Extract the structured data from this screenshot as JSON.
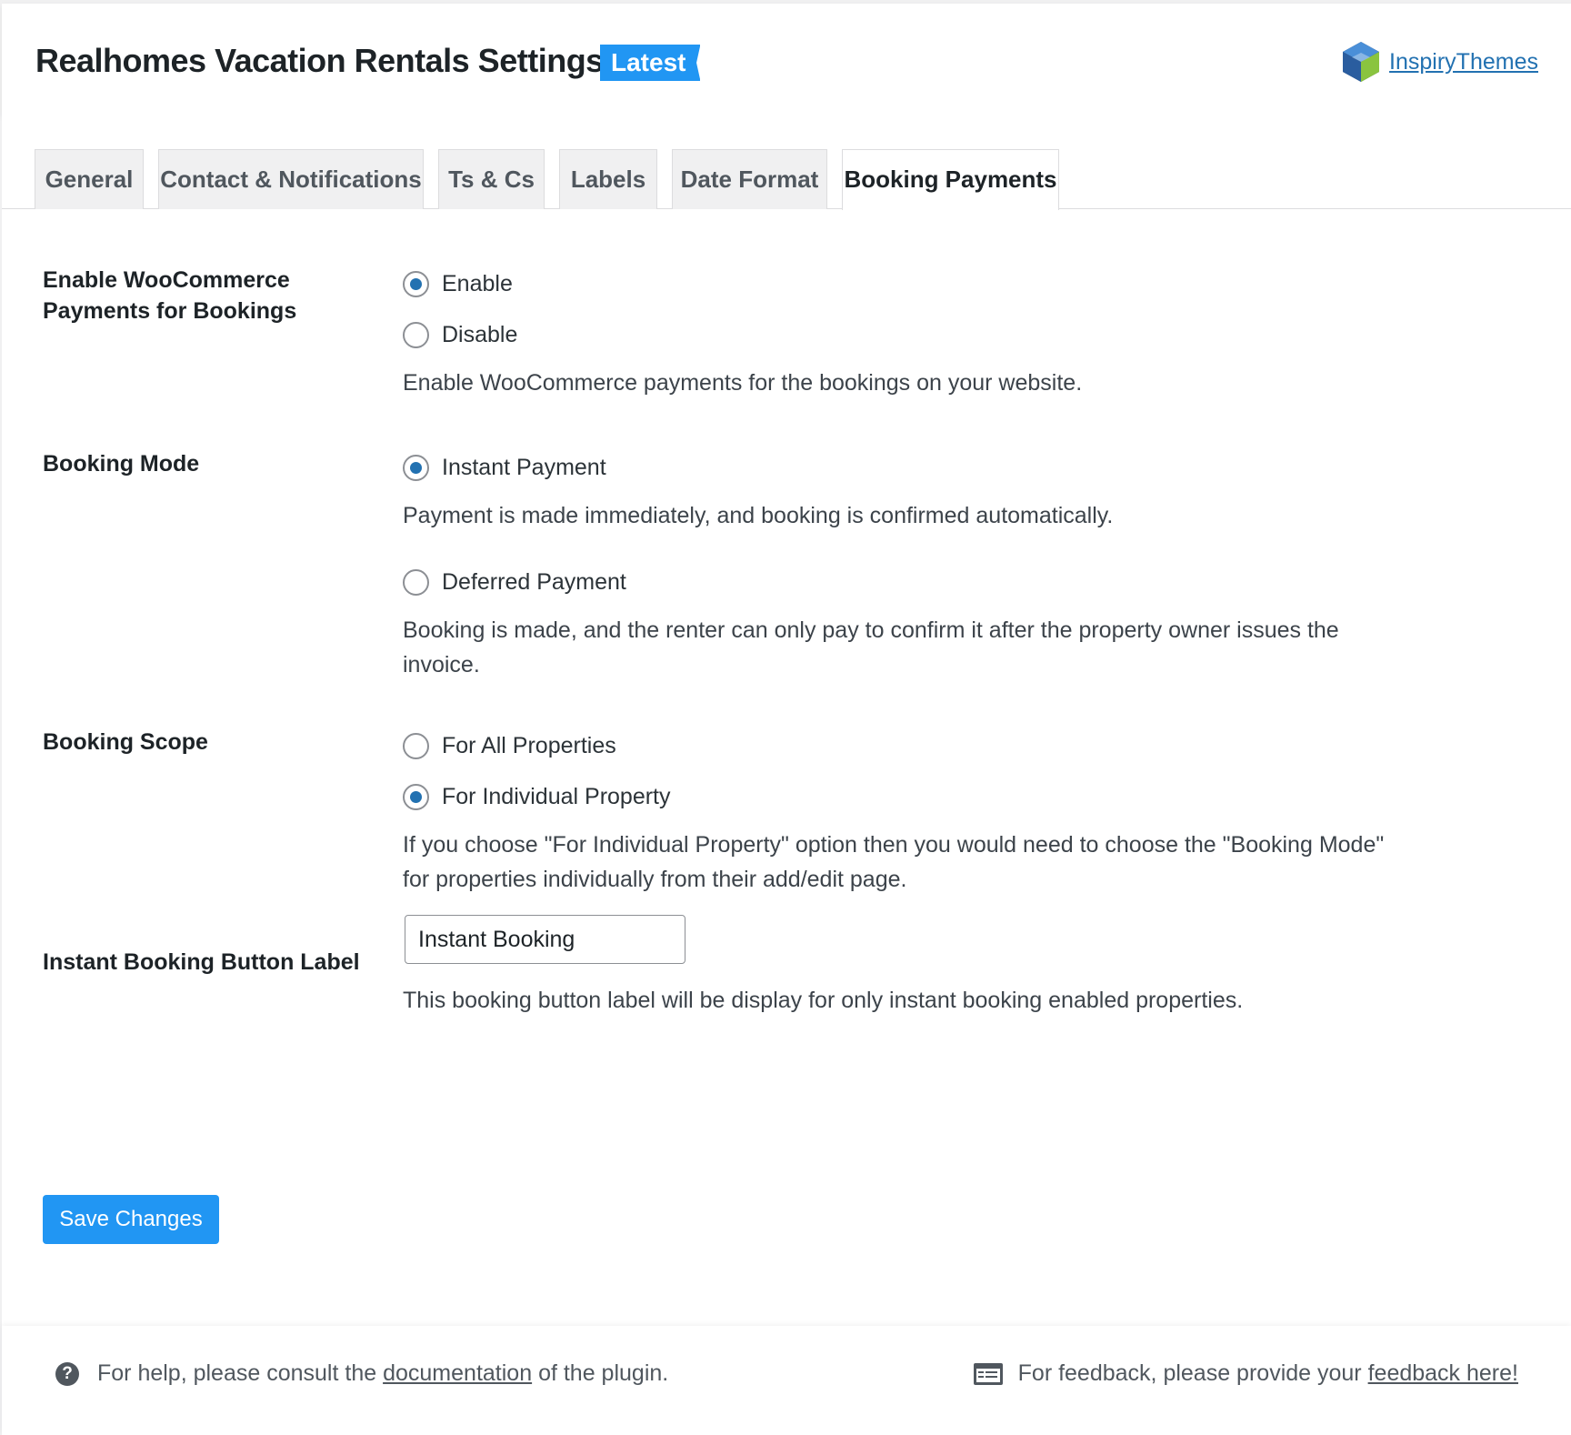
{
  "header": {
    "title": "Realhomes Vacation Rentals Settings",
    "badge": "Latest",
    "brand_name": "InspiryThemes",
    "brand_icon": "hexagon-cube-logo"
  },
  "tabs": [
    {
      "label": "General",
      "active": false
    },
    {
      "label": "Contact & Notifications",
      "active": false
    },
    {
      "label": "Ts & Cs",
      "active": false
    },
    {
      "label": "Labels",
      "active": false
    },
    {
      "label": "Date Format",
      "active": false
    },
    {
      "label": "Booking Payments",
      "active": true
    }
  ],
  "settings": {
    "woocommerce": {
      "label": "Enable WooCommerce Payments for Bookings",
      "options": [
        {
          "label": "Enable",
          "checked": true
        },
        {
          "label": "Disable",
          "checked": false
        }
      ],
      "description": "Enable WooCommerce payments for the bookings on your website."
    },
    "booking_mode": {
      "label": "Booking Mode",
      "options": [
        {
          "label": "Instant Payment",
          "checked": true,
          "description": "Payment is made immediately, and booking is confirmed automatically."
        },
        {
          "label": "Deferred Payment",
          "checked": false,
          "description": "Booking is made, and the renter can only pay to confirm it after the property owner issues the invoice."
        }
      ]
    },
    "booking_scope": {
      "label": "Booking Scope",
      "options": [
        {
          "label": "For All Properties",
          "checked": false
        },
        {
          "label": "For Individual Property",
          "checked": true
        }
      ],
      "description": "If you choose \"For Individual Property\" option then you would need to choose the \"Booking Mode\" for properties individually from their add/edit page."
    },
    "instant_label": {
      "label": "Instant Booking Button Label",
      "value": "Instant Booking",
      "description": "This booking button label will be display for only instant booking enabled properties."
    }
  },
  "save_label": "Save Changes",
  "footer": {
    "help_prefix": "For help, please consult the",
    "help_link": "documentation",
    "help_suffix": "of the plugin.",
    "feedback_prefix": "For feedback, please provide your",
    "feedback_link": "feedback here!"
  },
  "colors": {
    "accent": "#2196f3",
    "radio_checked": "#2271b1",
    "link": "#2271b1"
  }
}
